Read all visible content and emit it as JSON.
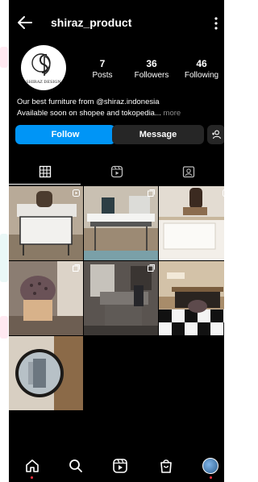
{
  "profile": {
    "username": "shiraz_product",
    "avatar_brand": "SHIRAZ DESIGN",
    "stats": [
      {
        "value": "7",
        "label": "Posts"
      },
      {
        "value": "36",
        "label": "Followers"
      },
      {
        "value": "46",
        "label": "Following"
      }
    ],
    "bio_line1": "Our best furniture from @shiraz.indonesia",
    "bio_line2": "Available soon on shopee and tokopedia...",
    "bio_more": "more"
  },
  "actions": {
    "follow_label": "Follow",
    "message_label": "Message"
  },
  "tabs": [
    {
      "icon": "grid-icon",
      "active": true
    },
    {
      "icon": "reels-icon",
      "active": false
    },
    {
      "icon": "tagged-icon",
      "active": false
    }
  ],
  "nav": [
    "home-icon",
    "search-icon",
    "reels-icon",
    "shop-icon",
    "profile-avatar"
  ],
  "colors": {
    "follow_button": "#0095f6",
    "message_button": "#262626",
    "accent": "#e1306c",
    "notification_dot": "#ff3040"
  }
}
